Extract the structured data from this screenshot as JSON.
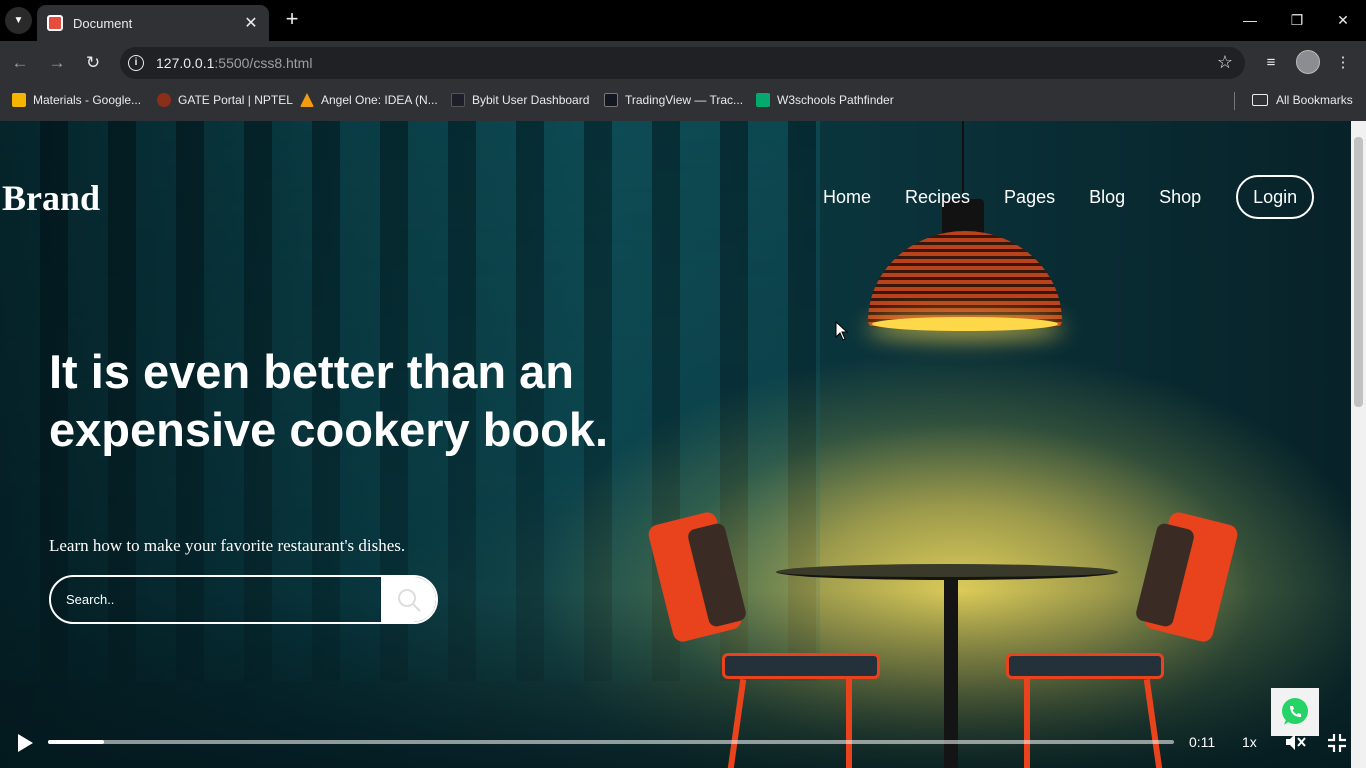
{
  "browser": {
    "tab_title": "Document",
    "url_host": "127.0.0.1",
    "url_rest": ":5500/css8.html",
    "bookmarks": [
      {
        "label": "Materials - Google...",
        "color": "#f4b400"
      },
      {
        "label": "GATE Portal | NPTEL",
        "color": "#8b2e1a"
      },
      {
        "label": "Angel One: IDEA (N...",
        "color": "#f39c12"
      },
      {
        "label": "Bybit User Dashboard",
        "color": "#1e1e2a"
      },
      {
        "label": "TradingView — Trac...",
        "color": "#131722"
      },
      {
        "label": "W3schools Pathfinder",
        "color": "#04aa6d"
      }
    ],
    "all_bookmarks": "All Bookmarks"
  },
  "site": {
    "brand": "Brand",
    "nav": [
      "Home",
      "Recipes",
      "Pages",
      "Blog",
      "Shop"
    ],
    "login": "Login",
    "hero_title": "It is even better than an expensive cookery book.",
    "hero_subtitle": "Learn how to make your favorite restaurant's dishes.",
    "search_placeholder": "Search.."
  },
  "player": {
    "time": "0:11",
    "speed": "1x",
    "progress_fraction": 0.05
  },
  "colors": {
    "accent_chair": "#e8431c",
    "lamp_light": "#ffd84a",
    "whatsapp_green": "#25d366"
  }
}
